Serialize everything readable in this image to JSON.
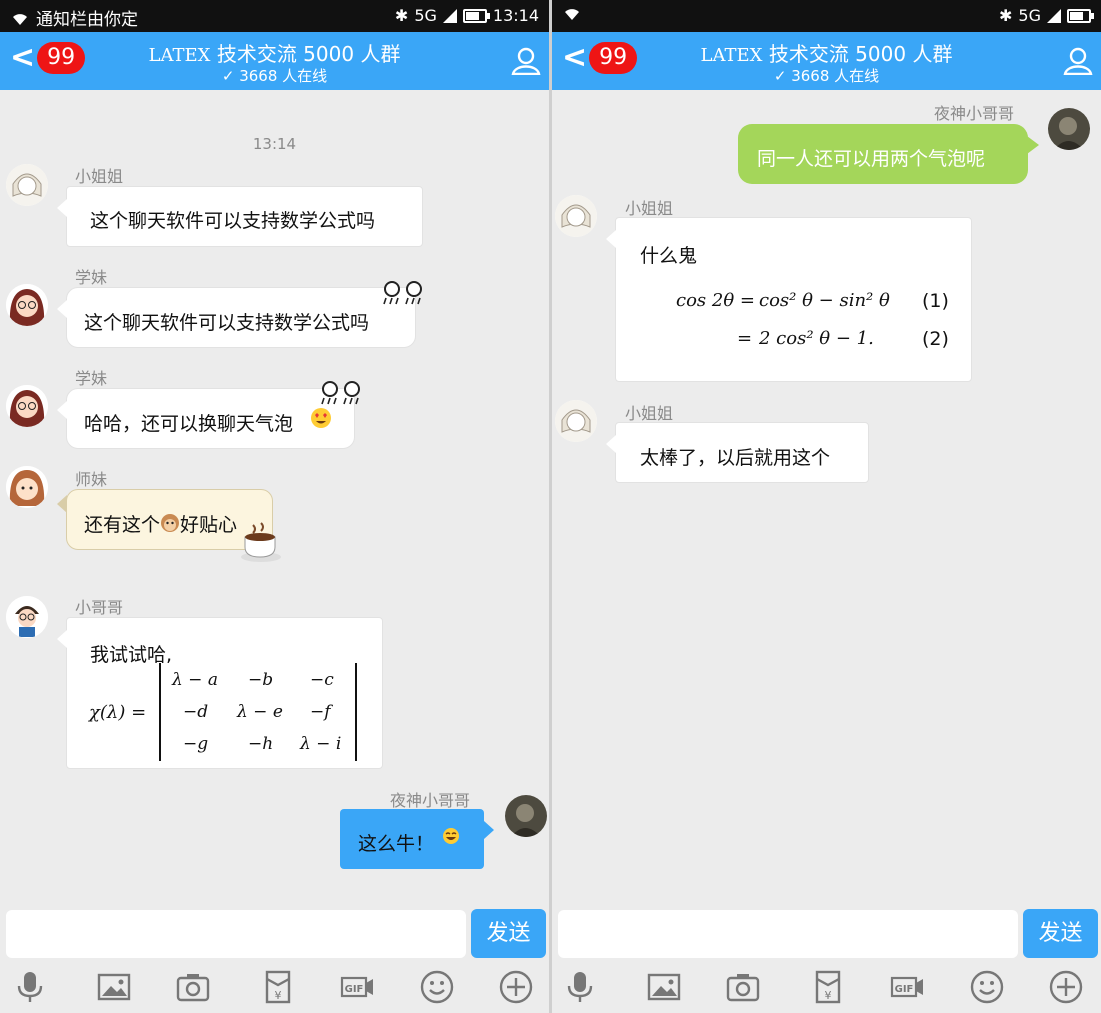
{
  "status_bar": {
    "left_notification": "通知栏由你定",
    "network": "5G",
    "time": "13:14"
  },
  "header": {
    "unread_badge": "99",
    "title": "技术交流 5000 人群",
    "logo_text": "LATEX",
    "online": "3668 人在线"
  },
  "left_chat": {
    "timestamp": "13:14",
    "messages": [
      {
        "sender": "小姐姐",
        "text": "这个聊天软件可以支持数学公式吗"
      },
      {
        "sender": "学妹",
        "text": "这个聊天软件可以支持数学公式吗"
      },
      {
        "sender": "学妹",
        "text": "哈哈，还可以换聊天气泡"
      },
      {
        "sender": "师妹",
        "text": "还有这个",
        "text_after": "好贴心"
      },
      {
        "sender": "小哥哥",
        "text": "我试试哈,",
        "formula": {
          "lhs": "χ(λ) =",
          "matrix": [
            [
              "λ − a",
              "−b",
              "−c"
            ],
            [
              "−d",
              "λ − e",
              "−f"
            ],
            [
              "−g",
              "−h",
              "λ − i"
            ]
          ]
        }
      },
      {
        "sender": "夜神小哥哥",
        "text": "这么牛！"
      }
    ]
  },
  "right_chat": {
    "messages": [
      {
        "sender": "夜神小哥哥",
        "text": "同一人还可以用两个气泡呢"
      },
      {
        "sender": "小姐姐",
        "text": "什么鬼",
        "equations": [
          {
            "lhs": "cos 2θ =",
            "rhs": "cos² θ − sin² θ",
            "number": "(1)"
          },
          {
            "lhs": "=",
            "rhs": "2 cos² θ − 1.",
            "number": "(2)"
          }
        ]
      },
      {
        "sender": "小姐姐",
        "text": "太棒了，以后就用这个"
      }
    ]
  },
  "input": {
    "send_label": "发送",
    "placeholder": ""
  },
  "toolbar": [
    "microphone-icon",
    "image-icon",
    "camera-icon",
    "red-packet-icon",
    "gif-icon",
    "emoji-icon",
    "plus-icon"
  ],
  "colors": {
    "header_blue": "#3aa6f7",
    "badge_red": "#ee1515",
    "bubble_green": "#a4d65a",
    "bubble_cream": "#fcf5df"
  }
}
